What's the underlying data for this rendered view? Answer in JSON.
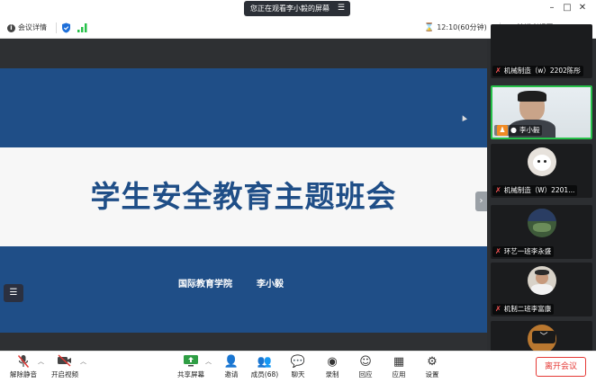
{
  "titlebar": {
    "share_status": "您正在观看李小毅的屏幕",
    "share_icon": "stop-share-icon",
    "minimize": "–",
    "maximize": "□",
    "close": "✕"
  },
  "toolbar": {
    "meeting_details": "会议详情",
    "timer": "12:10(60分钟)",
    "view_mode": "演讲者视图",
    "signal_strength": "good",
    "timer_icon": "hourglass-icon",
    "view_icon": "layout-icon"
  },
  "slide": {
    "title": "学生安全教育主题班会",
    "organization": "国际教育学院",
    "author": "李小毅",
    "colors": {
      "band": "#1f4e87",
      "middle": "#f7f7f7",
      "title": "#1f4e87"
    }
  },
  "gallery": {
    "participants": [
      {
        "name": "机械制造（w）2202陈彤",
        "mic": "muted"
      },
      {
        "name": "李小毅",
        "mic": "on",
        "active": true
      },
      {
        "name": "机械制造（W）2201...",
        "mic": "muted"
      },
      {
        "name": "环艺一班李永盛",
        "mic": "muted"
      },
      {
        "name": "机制二班李富康",
        "mic": "muted"
      }
    ],
    "active_color": "#27c14a"
  },
  "controls": {
    "unmute": "解除静音",
    "start_video": "开启视频",
    "share_screen": "共享屏幕",
    "invite": "邀请",
    "members": "成员(68)",
    "chat": "聊天",
    "record": "录制",
    "reactions": "回应",
    "apps": "应用",
    "settings": "设置",
    "leave": "离开会议"
  }
}
